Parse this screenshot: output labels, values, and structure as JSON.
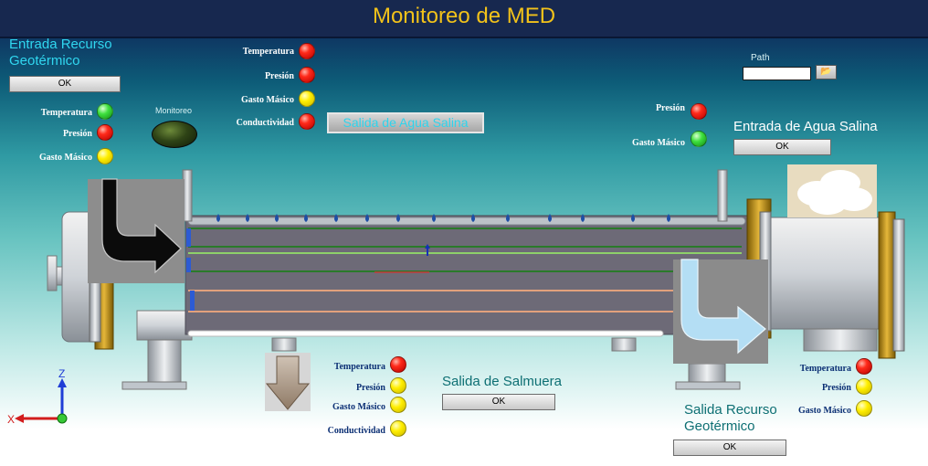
{
  "title": "Monitoreo de MED",
  "entrada_recurso": {
    "heading": "Entrada Recurso\nGeotérmico",
    "ok": "OK"
  },
  "top_indicators": [
    {
      "label": "Temperatura",
      "color": "red"
    },
    {
      "label": "Presión",
      "color": "red"
    },
    {
      "label": "Gasto Másico",
      "color": "yellow"
    },
    {
      "label": "Conductividad",
      "color": "red"
    }
  ],
  "salida_agua_salina_button": "Salida de Agua Salina",
  "left_indicators": [
    {
      "label": "Temperatura",
      "color": "green"
    },
    {
      "label": "Presión",
      "color": "red"
    },
    {
      "label": "Gasto Másico",
      "color": "yellow"
    }
  ],
  "monitoreo_label": "Monitoreo",
  "path": {
    "label": "Path",
    "value": ""
  },
  "entrada_agua_salina": {
    "heading": "Entrada de Agua Salina",
    "ok": "OK"
  },
  "right_top_indicators": [
    {
      "label": "Presión",
      "color": "red"
    },
    {
      "label": "Gasto Másico",
      "color": "green"
    }
  ],
  "bottom_indicators": [
    {
      "label": "Temperatura",
      "color": "red"
    },
    {
      "label": "Presión",
      "color": "yellow"
    },
    {
      "label": "Gasto Másico",
      "color": "yellow"
    },
    {
      "label": "Conductividad",
      "color": "yellow"
    }
  ],
  "salida_salmuera": {
    "heading": "Salida de Salmuera",
    "ok": "OK"
  },
  "salida_recurso": {
    "heading": "Salida Recurso\nGeotérmico",
    "ok": "OK"
  },
  "bottom_right_indicators": [
    {
      "label": "Temperatura",
      "color": "red"
    },
    {
      "label": "Presión",
      "color": "yellow"
    },
    {
      "label": "Gasto Másico",
      "color": "yellow"
    }
  ],
  "axes": {
    "z": "Z",
    "x": "X"
  },
  "colors": {
    "accent_title": "#f2c21a",
    "header_cyan": "#30d7f0",
    "header_sea": "#0d6f73",
    "bg_dark": "#17284f"
  }
}
